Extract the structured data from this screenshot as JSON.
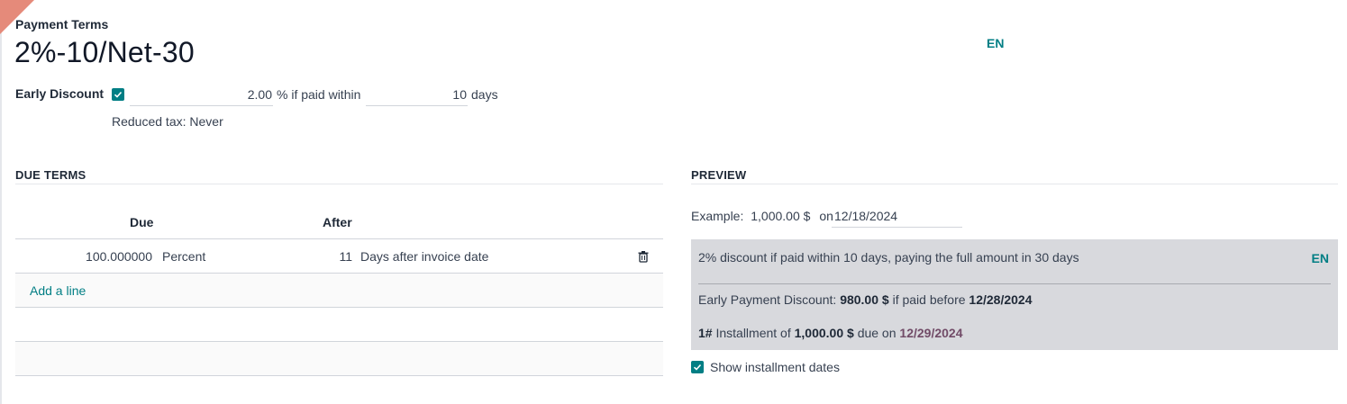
{
  "header": {
    "label": "Payment Terms",
    "title": "2%-10/Net-30",
    "lang": "EN"
  },
  "early_discount": {
    "label": "Early Discount",
    "checked": true,
    "percent": "2.00",
    "percent_suffix": "% if paid within",
    "days": "10",
    "days_suffix": "days",
    "reduced_tax": "Reduced tax: Never"
  },
  "due_terms": {
    "section_title": "DUE TERMS",
    "columns": {
      "due": "Due",
      "after": "After"
    },
    "rows": [
      {
        "value": "100.000000",
        "type": "Percent",
        "days": "11",
        "after_type": "Days after invoice date"
      }
    ],
    "add_line": "Add a line"
  },
  "preview": {
    "section_title": "PREVIEW",
    "example_prefix": "Example:",
    "amount": "1,000.00 $",
    "on_label": "on",
    "date": "12/18/2024",
    "sentence": "2% discount if paid within 10 days,  paying the full amount in 30 days",
    "lang": "EN",
    "early_payment": {
      "label": "Early Payment Discount:",
      "amount": "980.00 $",
      "middle": "if paid before",
      "date": "12/28/2024"
    },
    "installment": {
      "number": "1#",
      "label": "Installment of",
      "amount": "1,000.00 $",
      "middle": "due on",
      "date": "12/29/2024"
    },
    "show_installment_dates": "Show installment dates"
  },
  "colors": {
    "accent": "#017e84",
    "date_accent": "#714b67",
    "preview_bg": "#d8d9dd"
  }
}
